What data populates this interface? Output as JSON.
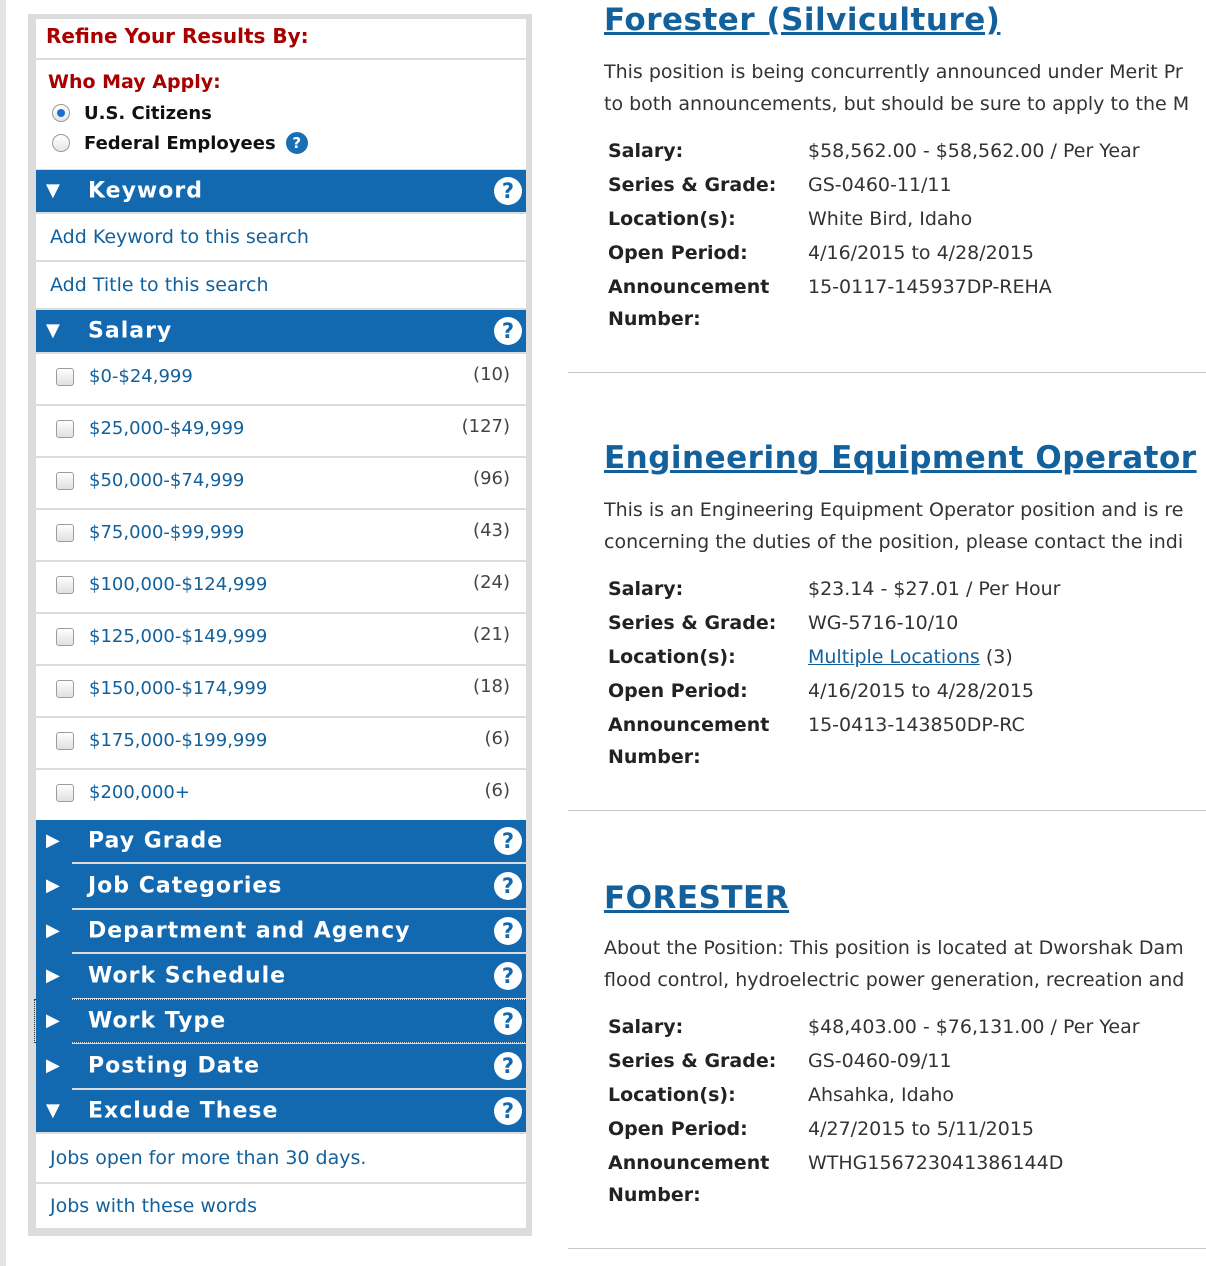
{
  "sidebar": {
    "refine_title": "Refine Your Results By:",
    "who_may_apply": {
      "title": "Who May Apply:",
      "options": [
        {
          "label": "U.S. Citizens",
          "selected": true
        },
        {
          "label": "Federal Employees",
          "selected": false
        }
      ],
      "help": "?"
    },
    "keyword": {
      "title": "Keyword",
      "arrow": "▼",
      "help": "?",
      "links": [
        "Add Keyword to this search",
        "Add Title to this search"
      ]
    },
    "salary": {
      "title": "Salary",
      "arrow": "▼",
      "help": "?",
      "ranges": [
        {
          "label": "$0-$24,999",
          "count": "(10)"
        },
        {
          "label": "$25,000-$49,999",
          "count": "(127)"
        },
        {
          "label": "$50,000-$74,999",
          "count": "(96)"
        },
        {
          "label": "$75,000-$99,999",
          "count": "(43)"
        },
        {
          "label": "$100,000-$124,999",
          "count": "(24)"
        },
        {
          "label": "$125,000-$149,999",
          "count": "(21)"
        },
        {
          "label": "$150,000-$174,999",
          "count": "(18)"
        },
        {
          "label": "$175,000-$199,999",
          "count": "(6)"
        },
        {
          "label": "$200,000+",
          "count": "(6)"
        }
      ]
    },
    "collapsed_sections": [
      {
        "title": "Pay Grade",
        "arrow": "▶",
        "help": "?"
      },
      {
        "title": "Job Categories",
        "arrow": "▶",
        "help": "?"
      },
      {
        "title": "Department and Agency",
        "arrow": "▶",
        "help": "?"
      },
      {
        "title": "Work Schedule",
        "arrow": "▶",
        "help": "?"
      },
      {
        "title": "Work Type",
        "arrow": "▶",
        "help": "?"
      },
      {
        "title": "Posting Date",
        "arrow": "▶",
        "help": "?"
      }
    ],
    "exclude": {
      "title": "Exclude These",
      "arrow": "▼",
      "help": "?",
      "links": [
        "Jobs open for more than 30 days.",
        "Jobs with these words"
      ]
    }
  },
  "labels": {
    "salary": "Salary:",
    "series_grade": "Series & Grade:",
    "locations": "Location(s):",
    "open_period": "Open Period:",
    "announcement": "Announcement",
    "number": "Number:"
  },
  "results": [
    {
      "title": "Forester (Silviculture)",
      "desc_line1": "This position is being concurrently announced under Merit Pr",
      "desc_line2": "to both announcements, but should be sure to apply to the M",
      "salary": "$58,562.00 - $58,562.00 / Per Year",
      "series_grade": "GS-0460-11/11",
      "location": "White Bird, Idaho",
      "location_link": "",
      "location_count": "",
      "open_period": "4/16/2015 to 4/28/2015",
      "announcement": "15-0117-145937DP-REHA"
    },
    {
      "title": "Engineering Equipment Operator",
      "desc_line1": "This is an Engineering Equipment Operator position and is re",
      "desc_line2": "concerning the duties of the position, please contact the indi",
      "salary": "$23.14 - $27.01 / Per Hour",
      "series_grade": "WG-5716-10/10",
      "location": "",
      "location_link": "Multiple Locations",
      "location_count": " (3)",
      "open_period": "4/16/2015 to 4/28/2015",
      "announcement": "15-0413-143850DP-RC"
    },
    {
      "title": "FORESTER",
      "desc_line1": "About the Position: This position is located at Dworshak Dam",
      "desc_line2": "flood control, hydroelectric power generation, recreation and",
      "salary": "$48,403.00 - $76,131.00 / Per Year",
      "series_grade": "GS-0460-09/11",
      "location": "Ahsahka, Idaho",
      "location_link": "",
      "location_count": "",
      "open_period": "4/27/2015 to 5/11/2015",
      "announcement": "WTHG156723041386144D"
    }
  ]
}
